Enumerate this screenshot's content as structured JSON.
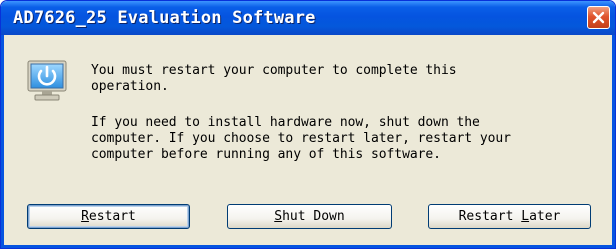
{
  "window": {
    "title": "AD7626_25 Evaluation Software"
  },
  "icons": {
    "app": "power-monitor-icon",
    "close": "close-icon"
  },
  "message": {
    "line1": "You must restart your computer to complete this\noperation.",
    "line2": "If you need to install hardware now, shut down the\ncomputer. If you choose to restart later, restart your\ncomputer before running any of this software."
  },
  "buttons": {
    "restart": {
      "mnemonic": "R",
      "rest": "estart"
    },
    "shutdown": {
      "mnemonic": "S",
      "rest": "hut Down"
    },
    "later": {
      "pre": "Restart ",
      "mnemonic": "L",
      "rest": "ater"
    }
  },
  "colors": {
    "titlebar": "#0554e0",
    "dialog_bg": "#ece9d8",
    "close": "#e0542d"
  }
}
